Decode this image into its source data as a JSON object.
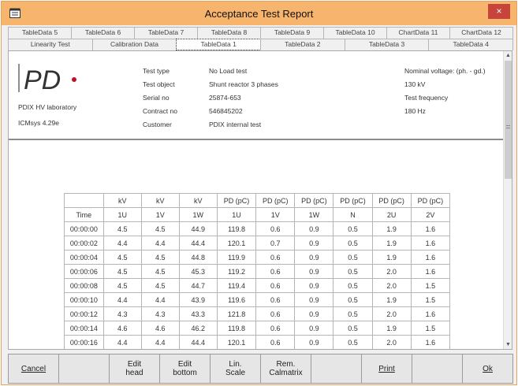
{
  "window": {
    "title": "Acceptance Test Report",
    "close_label": "×"
  },
  "tabs_row1": [
    "TableData 5",
    "TableData 6",
    "TableData 7",
    "TableData 8",
    "TableData 9",
    "TableData 10",
    "ChartData 11",
    "ChartData 12"
  ],
  "tabs_row2": [
    "Linearity Test",
    "Calibration Data",
    "TableData 1",
    "TableData 2",
    "TableData 3",
    "TableData 4"
  ],
  "active_tab": "TableData 1",
  "header": {
    "logo_text": "PD",
    "lab_name": "PDIX HV laboratory",
    "software": "ICMsys 4.29e",
    "fields": [
      {
        "label": "Test type",
        "value": "No Load test"
      },
      {
        "label": "Test object",
        "value": "Shunt reactor 3 phases"
      },
      {
        "label": "Serial no",
        "value": "25874-653"
      },
      {
        "label": "Contract no",
        "value": "546845202"
      },
      {
        "label": "Customer",
        "value": "PDIX internal test"
      }
    ],
    "right": [
      "Nominal voltage: (ph. - gd.)",
      "130 kV",
      "Test frequency",
      "180 Hz"
    ]
  },
  "table": {
    "units": [
      "",
      "kV",
      "kV",
      "kV",
      "PD (pC)",
      "PD (pC)",
      "PD (pC)",
      "PD (pC)",
      "PD (pC)",
      "PD (pC)"
    ],
    "columns": [
      "Time",
      "1U",
      "1V",
      "1W",
      "1U",
      "1V",
      "1W",
      "N",
      "2U",
      "2V"
    ],
    "rows": [
      [
        "00:00:00",
        "4.5",
        "4.5",
        "44.9",
        "119.8",
        "0.6",
        "0.9",
        "0.5",
        "1.9",
        "1.6"
      ],
      [
        "00:00:02",
        "4.4",
        "4.4",
        "44.4",
        "120.1",
        "0.7",
        "0.9",
        "0.5",
        "1.9",
        "1.6"
      ],
      [
        "00:00:04",
        "4.5",
        "4.5",
        "44.8",
        "119.9",
        "0.6",
        "0.9",
        "0.5",
        "1.9",
        "1.6"
      ],
      [
        "00:00:06",
        "4.5",
        "4.5",
        "45.3",
        "119.2",
        "0.6",
        "0.9",
        "0.5",
        "2.0",
        "1.6"
      ],
      [
        "00:00:08",
        "4.5",
        "4.5",
        "44.7",
        "119.4",
        "0.6",
        "0.9",
        "0.5",
        "2.0",
        "1.5"
      ],
      [
        "00:00:10",
        "4.4",
        "4.4",
        "43.9",
        "119.6",
        "0.6",
        "0.9",
        "0.5",
        "1.9",
        "1.5"
      ],
      [
        "00:00:12",
        "4.3",
        "4.3",
        "43.3",
        "121.8",
        "0.6",
        "0.9",
        "0.5",
        "2.0",
        "1.6"
      ],
      [
        "00:00:14",
        "4.6",
        "4.6",
        "46.2",
        "119.8",
        "0.6",
        "0.9",
        "0.5",
        "1.9",
        "1.5"
      ],
      [
        "00:00:16",
        "4.4",
        "4.4",
        "44.4",
        "120.1",
        "0.6",
        "0.9",
        "0.5",
        "2.0",
        "1.6"
      ],
      [
        "00:00:18",
        "4.4",
        "4.4",
        "44.2",
        "118.9",
        "0.6",
        "0.9",
        "0.5",
        "1.9",
        "1.6"
      ]
    ]
  },
  "buttons": [
    {
      "name": "cancel-button",
      "label": "Cancel",
      "underline": true
    },
    {
      "name": "blank-button-1",
      "label": ""
    },
    {
      "name": "edit-head-button",
      "label": "Edit\nhead"
    },
    {
      "name": "edit-bottom-button",
      "label": "Edit\nbottom"
    },
    {
      "name": "lin-scale-button",
      "label": "Lin.\nScale"
    },
    {
      "name": "rem-calmatrix-button",
      "label": "Rem.\nCalmatrix"
    },
    {
      "name": "blank-button-2",
      "label": ""
    },
    {
      "name": "print-button",
      "label": "Print",
      "underline": true
    },
    {
      "name": "blank-button-3",
      "label": ""
    },
    {
      "name": "ok-button",
      "label": "Ok",
      "underline": true
    }
  ],
  "colors": {
    "titlebar": "#f7b46c",
    "close": "#c7443a",
    "logo_dot": "#c0102a"
  }
}
